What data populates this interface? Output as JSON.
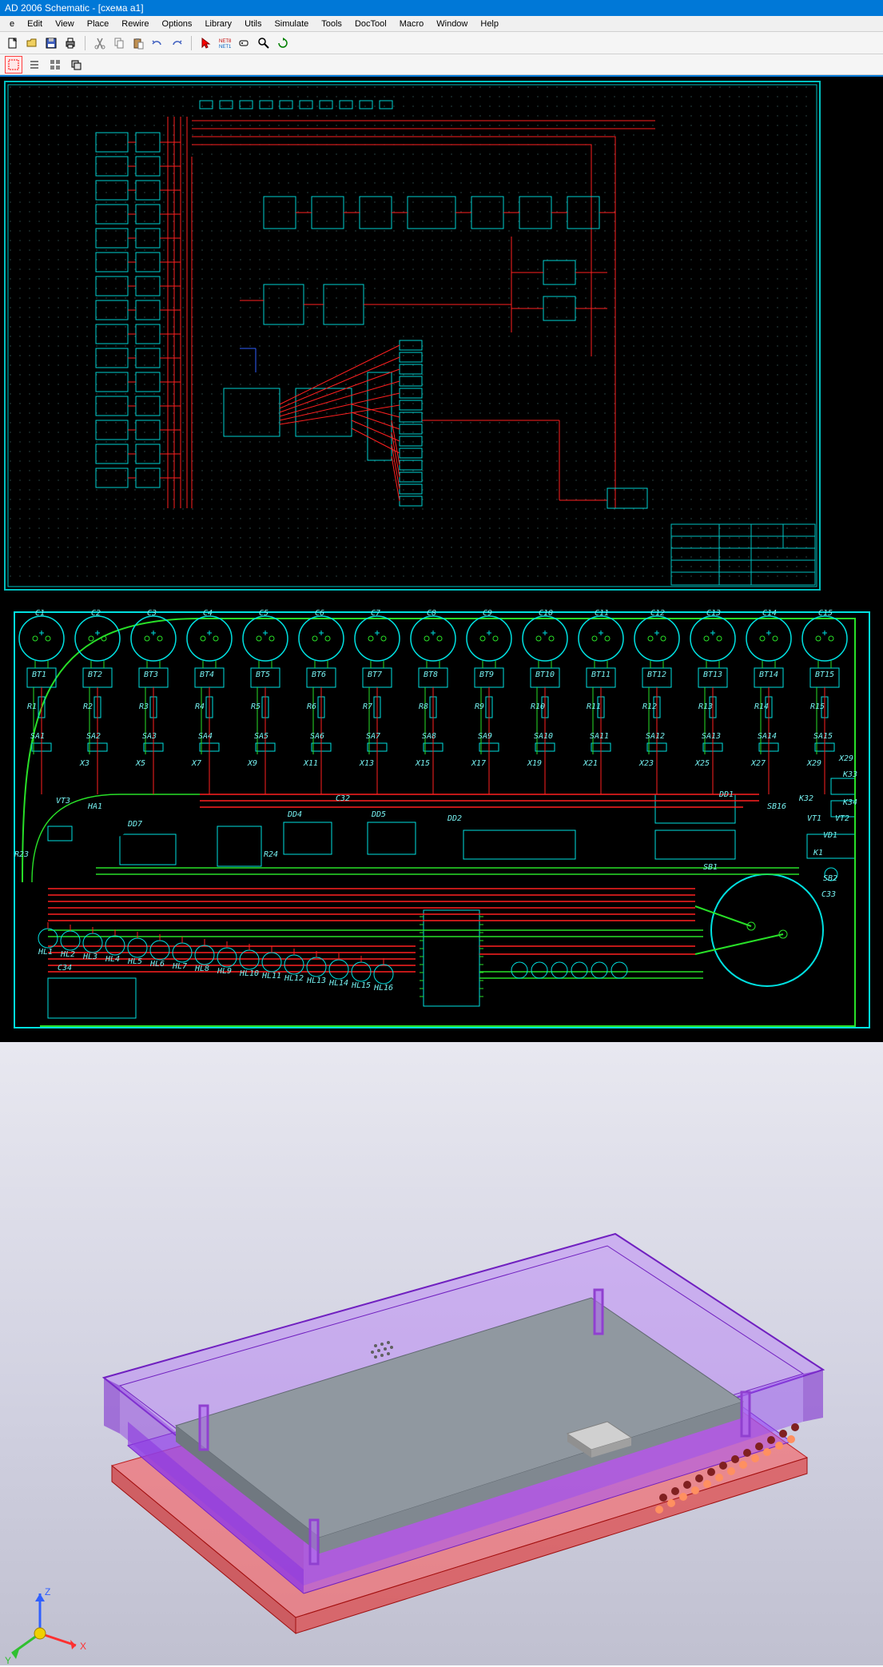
{
  "title": "AD 2006 Schematic - [схема a1]",
  "menu": [
    "e",
    "Edit",
    "View",
    "Place",
    "Rewire",
    "Options",
    "Library",
    "Utils",
    "Simulate",
    "Tools",
    "DocTool",
    "Macro",
    "Window",
    "Help"
  ],
  "toolbar": {
    "new": "New",
    "open": "Open",
    "save": "Save",
    "print": "Print",
    "cut": "Cut",
    "copy": "Copy",
    "paste": "Paste",
    "undo": "Undo",
    "redo": "Redo",
    "arrow": "Select",
    "net": "Net Name",
    "tag": "Tag",
    "zoom": "Zoom",
    "refresh": "Refresh"
  },
  "toolbar2": {
    "select": "Select Mode",
    "list": "List",
    "grid": "Grid",
    "layers": "Layers"
  },
  "schematic": {
    "title_block": ""
  },
  "pcb": {
    "caps": [
      "C1",
      "C2",
      "C3",
      "C4",
      "C5",
      "C6",
      "C7",
      "C8",
      "C9",
      "C10",
      "C11",
      "C12",
      "C13",
      "C14",
      "C15"
    ],
    "bridges": [
      "BT1",
      "BT2",
      "BT3",
      "BT4",
      "BT5",
      "BT6",
      "BT7",
      "BT8",
      "BT9",
      "BT10",
      "BT11",
      "BT12",
      "BT13",
      "BT14",
      "BT15"
    ],
    "res": [
      "R1",
      "R2",
      "R3",
      "R4",
      "R5",
      "R6",
      "R7",
      "R8",
      "R9",
      "R10",
      "R11",
      "R12",
      "R13",
      "R14",
      "R15",
      "R23",
      "R24"
    ],
    "sa": [
      "SA1",
      "SA2",
      "SA3",
      "SA4",
      "SA5",
      "SA6",
      "SA7",
      "SA8",
      "SA9",
      "SA10",
      "SA11",
      "SA12",
      "SA13",
      "SA14",
      "SA15"
    ],
    "x": [
      "X3",
      "X5",
      "X7",
      "X9",
      "X11",
      "X13",
      "X15",
      "X17",
      "X19",
      "X21",
      "X23",
      "X25",
      "X27",
      "X29"
    ],
    "labels": {
      "vt3": "VT3",
      "ha1": "HA1",
      "dd7": "DD7",
      "dd4": "DD4",
      "dd5": "DD5",
      "dd2": "DD2",
      "dd1": "DD1",
      "sb1": "SB1",
      "sb2": "SB2",
      "sb16": "SB16",
      "k1": "K1",
      "k32": "K32",
      "k33": "K33",
      "k34": "K34",
      "c32": "C32",
      "c33": "C33",
      "c34": "C34",
      "vt1": "VT1",
      "vt2": "VT2",
      "vd1": "VD1",
      "hl": [
        "HL1",
        "HL2",
        "HL3",
        "HL4",
        "HL5",
        "HL6",
        "HL7",
        "HL8",
        "HL9",
        "HL10",
        "HL11",
        "HL12",
        "HL13",
        "HL14",
        "HL15",
        "HL16"
      ]
    }
  },
  "view3d": {
    "axes": [
      "X",
      "Y",
      "Z"
    ]
  }
}
